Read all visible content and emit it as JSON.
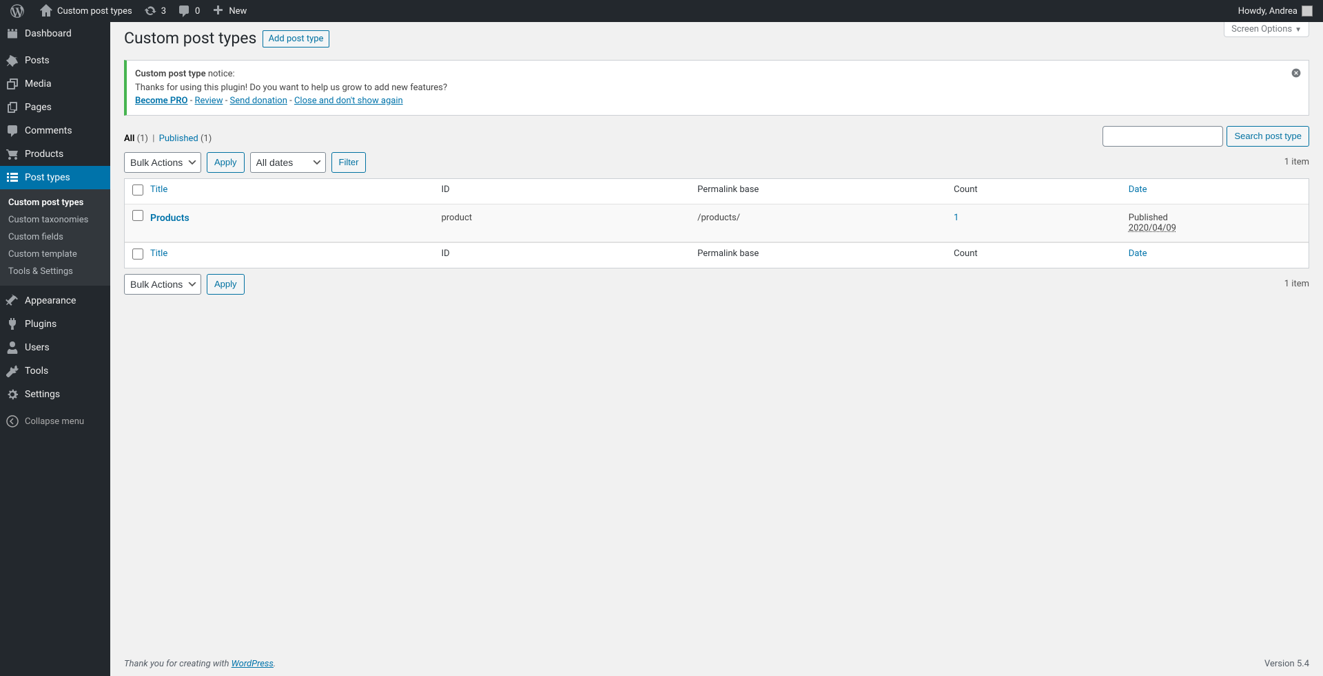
{
  "adminbar": {
    "site_name": "Custom post types",
    "updates": "3",
    "comments": "0",
    "new": "New",
    "greeting": "Howdy, Andrea"
  },
  "sidebar": {
    "items": [
      {
        "label": "Dashboard"
      },
      {
        "label": "Posts"
      },
      {
        "label": "Media"
      },
      {
        "label": "Pages"
      },
      {
        "label": "Comments"
      },
      {
        "label": "Products"
      },
      {
        "label": "Post types"
      },
      {
        "label": "Appearance"
      },
      {
        "label": "Plugins"
      },
      {
        "label": "Users"
      },
      {
        "label": "Tools"
      },
      {
        "label": "Settings"
      }
    ],
    "submenu": [
      {
        "label": "Custom post types"
      },
      {
        "label": "Custom taxonomies"
      },
      {
        "label": "Custom fields"
      },
      {
        "label": "Custom template"
      },
      {
        "label": "Tools & Settings"
      }
    ],
    "collapse": "Collapse menu"
  },
  "page": {
    "title": "Custom post types",
    "add_button": "Add post type",
    "screen_options": "Screen Options"
  },
  "notice": {
    "strong": "Custom post type",
    "suffix": " notice:",
    "body": "Thanks for using this plugin! Do you want to help us grow to add new features?",
    "links": {
      "pro": "Become PRO",
      "review": "Review",
      "donate": "Send donation",
      "close": "Close and don't show again"
    }
  },
  "subsubsub": {
    "all_label": "All",
    "all_count": "(1)",
    "published_label": "Published",
    "published_count": "(1)"
  },
  "filters": {
    "bulk": "Bulk Actions",
    "apply": "Apply",
    "dates": "All dates",
    "filter": "Filter",
    "search_button": "Search post type",
    "items": "1 item"
  },
  "table": {
    "headers": {
      "title": "Title",
      "id": "ID",
      "permalink": "Permalink base",
      "count": "Count",
      "date": "Date"
    },
    "rows": [
      {
        "title": "Products",
        "id": "product",
        "permalink": "/products/",
        "count": "1",
        "date_status": "Published",
        "date": "2020/04/09"
      }
    ]
  },
  "footer": {
    "text": "Thank you for creating with ",
    "wordpress": "WordPress",
    "dot": ".",
    "version": "Version 5.4"
  }
}
